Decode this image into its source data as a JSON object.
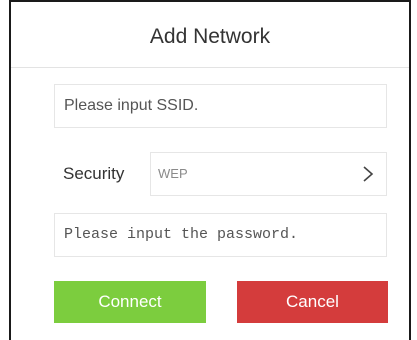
{
  "dialog": {
    "title": "Add Network"
  },
  "ssid": {
    "placeholder": "Please input SSID."
  },
  "security": {
    "label": "Security",
    "selected_value": "WEP",
    "chevron_icon": "chevron-right-icon"
  },
  "password": {
    "placeholder": "Please input the password."
  },
  "buttons": {
    "connect_label": "Connect",
    "cancel_label": "Cancel"
  },
  "colors": {
    "connect": "#7ccd3e",
    "cancel": "#d43c3c",
    "border": "#e6e6e6",
    "title_text": "#333333"
  }
}
